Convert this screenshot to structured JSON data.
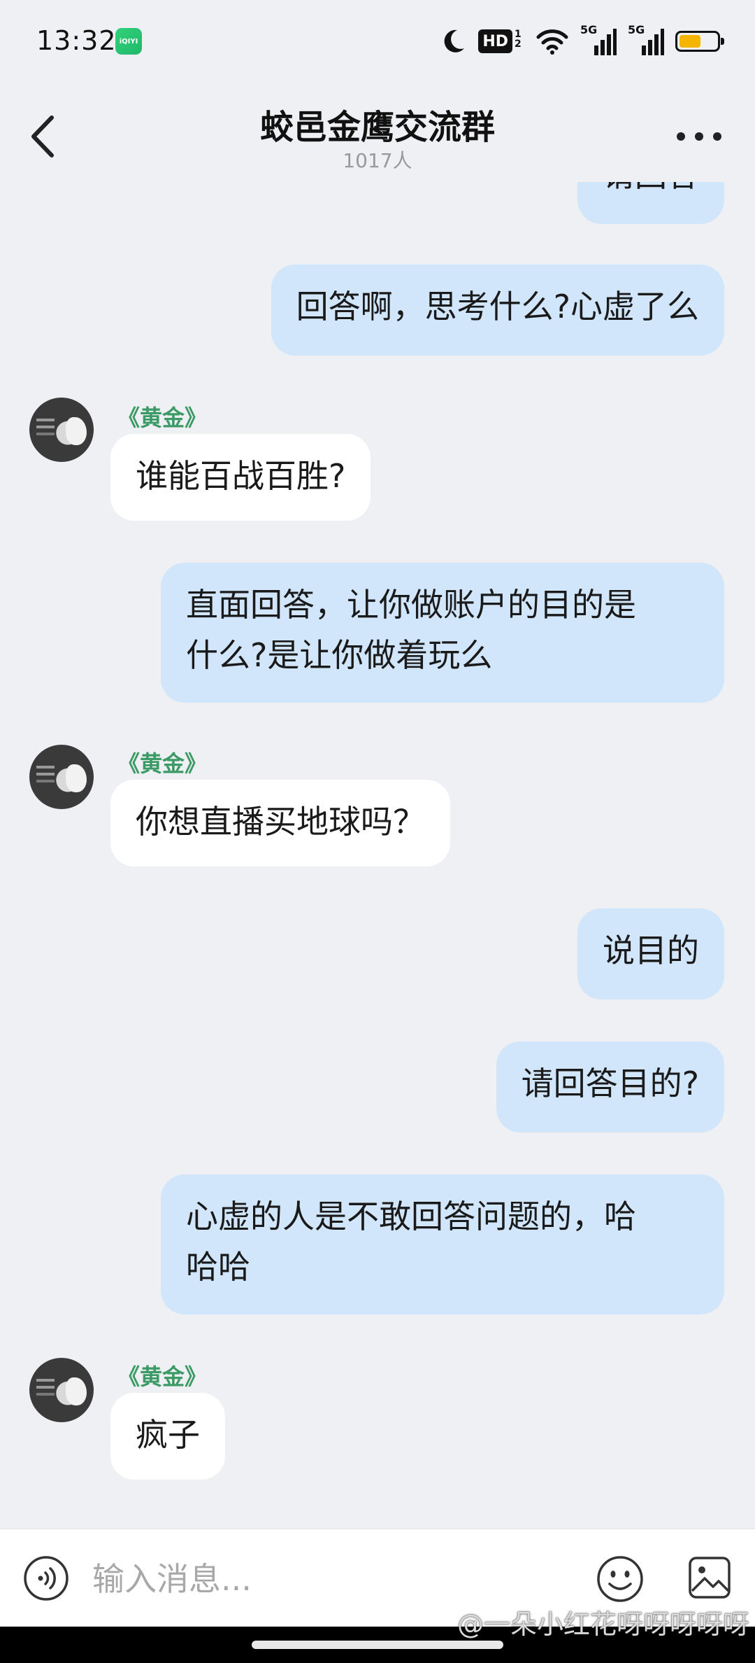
{
  "status_bar": {
    "time": "13:32",
    "app_badge": "iQIYI",
    "hd": "HD",
    "hd_sub": "1 2",
    "signal1_label": "5G",
    "signal2_label": "5G",
    "battery_level": 0.58,
    "battery_color": "#F5B400"
  },
  "header": {
    "title": "蛟邑金鹰交流群",
    "member_count": "1017人",
    "back_icon": "chevron-left-icon",
    "more_icon": "more-horizontal-icon"
  },
  "messages": [
    {
      "direction": "out",
      "text": "请回答"
    },
    {
      "direction": "out",
      "text": "回答啊，思考什么?心虚了么"
    },
    {
      "direction": "in",
      "sender": "《黄金》",
      "text": "谁能百战百胜?"
    },
    {
      "direction": "out",
      "text": "直面回答，让你做账户的目的是\n什么?是让你做着玩么"
    },
    {
      "direction": "in",
      "sender": "《黄金》",
      "text": "你想直播买地球吗？"
    },
    {
      "direction": "out",
      "text": "说目的"
    },
    {
      "direction": "out",
      "text": "请回答目的?"
    },
    {
      "direction": "out",
      "text": "心虚的人是不敢回答问题的，哈\n哈哈"
    },
    {
      "direction": "in",
      "sender": "《黄金》",
      "text": "疯子"
    }
  ],
  "input_bar": {
    "placeholder": "输入消息...",
    "icons": [
      "voice-icon",
      "emoji-icon",
      "image-icon"
    ]
  },
  "watermark": "@一朵小红花呀呀呀呀呀",
  "colors": {
    "background": "#EEF0F3",
    "outgoing_bubble": "#D2E6FB",
    "incoming_bubble": "#FFFFFF",
    "sender_name": "#3C9A66"
  }
}
